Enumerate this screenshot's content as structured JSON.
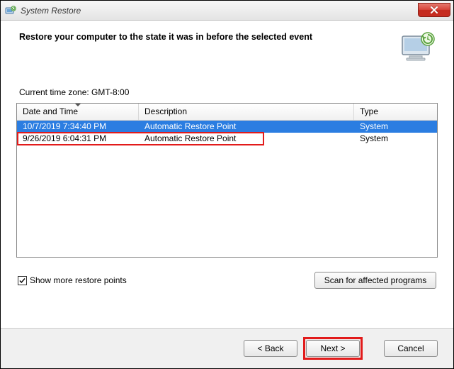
{
  "window": {
    "title": "System Restore"
  },
  "header": {
    "heading": "Restore your computer to the state it was in before the selected event"
  },
  "timezone_label_prefix": "Current time zone: ",
  "timezone_value": "GMT-8:00",
  "table": {
    "columns": {
      "datetime": "Date and Time",
      "description": "Description",
      "type": "Type"
    },
    "rows": [
      {
        "datetime": "10/7/2019 7:34:40 PM",
        "description": "Automatic Restore Point",
        "type": "System",
        "selected": true
      },
      {
        "datetime": "9/26/2019 6:04:31 PM",
        "description": "Automatic Restore Point",
        "type": "System",
        "highlighted": true
      }
    ]
  },
  "show_more": {
    "checked": true,
    "label": "Show more restore points"
  },
  "buttons": {
    "scan": "Scan for affected programs",
    "back": "< Back",
    "next": "Next >",
    "cancel": "Cancel"
  }
}
